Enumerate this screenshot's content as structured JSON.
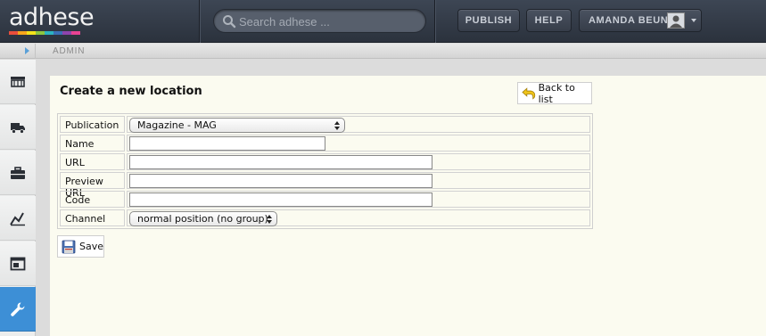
{
  "app": {
    "logo_text": "adhese",
    "logo_colors": [
      "#e94e3c",
      "#f7a51c",
      "#f3e21b",
      "#8cc63f",
      "#2bb3c0",
      "#3b6fb6",
      "#8e44ad",
      "#e84393"
    ]
  },
  "topbar": {
    "search_placeholder": "Search adhese ...",
    "publish_label": "PUBLISH",
    "help_label": "HELP",
    "user_name": "AMANDA BEUN"
  },
  "breadcrumb": {
    "text": "ADMIN"
  },
  "sidebar": {
    "items": [
      {
        "icon": "inventory-icon"
      },
      {
        "icon": "truck-icon"
      },
      {
        "icon": "toolbox-icon"
      },
      {
        "icon": "chart-icon"
      },
      {
        "icon": "window-icon"
      },
      {
        "icon": "wrench-icon",
        "active": true
      }
    ]
  },
  "page": {
    "title": "Create a new location",
    "back_label": "Back to list",
    "save_label": "Save"
  },
  "form": {
    "publication_label": "Publication",
    "publication_value": "Magazine - MAG",
    "name_label": "Name",
    "name_value": "",
    "url_label": "URL",
    "url_value": "",
    "preview_url_label": "Preview URL",
    "preview_url_value": "",
    "code_label": "Code",
    "code_value": "",
    "channel_label": "Channel",
    "channel_value": "normal position (no group)"
  },
  "colors": {
    "topbar": "#2f3641",
    "accent": "#3d8fd6",
    "panel": "#fbfbf0"
  }
}
